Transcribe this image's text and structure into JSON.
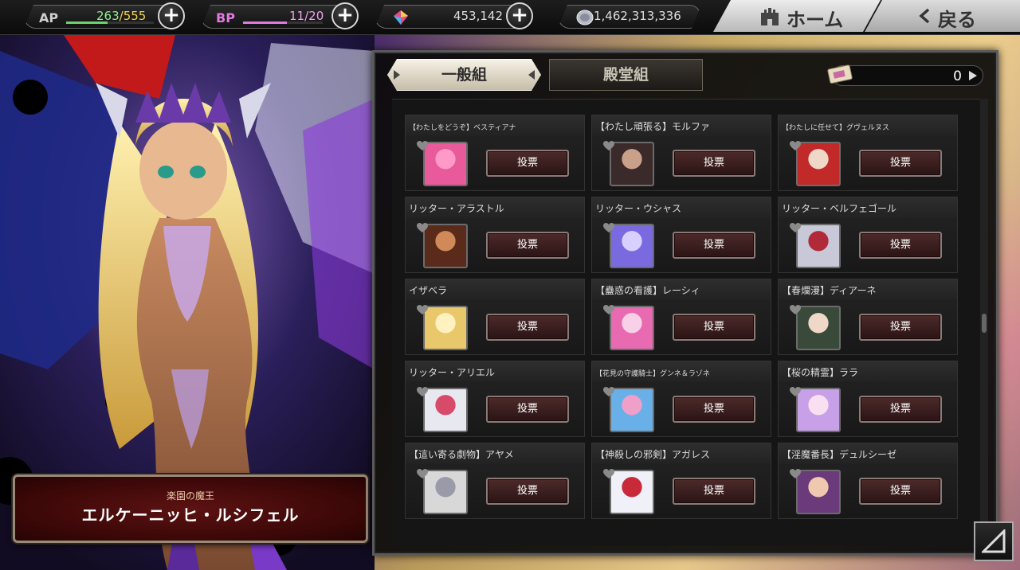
{
  "topbar": {
    "ap": {
      "label": "AP",
      "current": "263",
      "max": "/555",
      "fill": 0.47,
      "color": "#6bd36b"
    },
    "bp": {
      "label": "BP",
      "current": "11",
      "max": "/20",
      "fill": 0.55,
      "color": "#e07ae0"
    },
    "gems": {
      "icon": "rainbow-gem-icon",
      "value": "453,142"
    },
    "coins": {
      "icon": "silver-coin-icon",
      "value": "1,462,313,336"
    },
    "home_label": "ホーム",
    "back_label": "戻る"
  },
  "character": {
    "title": "楽園の魔王",
    "name": "エルケーニッヒ・ルシフェル"
  },
  "panel": {
    "tabs": [
      {
        "label": "一般組",
        "active": true
      },
      {
        "label": "殿堂組",
        "active": false
      }
    ],
    "ticket_count": "0",
    "vote_label": "投票",
    "candidates": [
      {
        "name": "【わたしをどうぞ】ベスティアナ",
        "small": true,
        "colors": [
          "#e85a9a",
          "#ff9ac8"
        ]
      },
      {
        "name": "【わたし頑張る】モルファ",
        "small": false,
        "colors": [
          "#3a2a2a",
          "#c9a08a"
        ]
      },
      {
        "name": "【わたしに任せて】グヴェルヌス",
        "small": true,
        "colors": [
          "#c22a2a",
          "#f0d8c8"
        ]
      },
      {
        "name": "リッター・アラストル",
        "small": false,
        "colors": [
          "#5a2a1a",
          "#d08a5a"
        ]
      },
      {
        "name": "リッター・ウシャス",
        "small": false,
        "colors": [
          "#7a6ae0",
          "#d8d0ff"
        ]
      },
      {
        "name": "リッター・ベルフェゴール",
        "small": false,
        "colors": [
          "#c8c8d8",
          "#b02a3a"
        ]
      },
      {
        "name": "イザベラ",
        "small": false,
        "colors": [
          "#e8c86a",
          "#fff2c0"
        ]
      },
      {
        "name": "【蠱惑の看護】レーシィ",
        "small": false,
        "colors": [
          "#e86ab0",
          "#f8d0e8"
        ]
      },
      {
        "name": "【春爛漫】ディアーネ",
        "small": false,
        "colors": [
          "#3a4a3a",
          "#f0d8c8"
        ]
      },
      {
        "name": "リッター・アリエル",
        "small": false,
        "colors": [
          "#e8e8f0",
          "#d84a6a"
        ]
      },
      {
        "name": "【花見の守護騎士】グンネ＆ラゾネ",
        "small": true,
        "colors": [
          "#6ab0e8",
          "#f0a0c8"
        ]
      },
      {
        "name": "【桜の精霊】ララ",
        "small": false,
        "colors": [
          "#c8a0e8",
          "#f8e0f0"
        ]
      },
      {
        "name": "【這い寄る劇物】アヤメ",
        "small": false,
        "colors": [
          "#d8d8d8",
          "#9a9aa8"
        ]
      },
      {
        "name": "【神殺しの邪剣】アガレス",
        "small": false,
        "colors": [
          "#f0f0f8",
          "#c82a3a"
        ]
      },
      {
        "name": "【淫魔番長】デュルシーゼ",
        "small": false,
        "colors": [
          "#6a3a7a",
          "#f0c8b0"
        ]
      }
    ]
  }
}
